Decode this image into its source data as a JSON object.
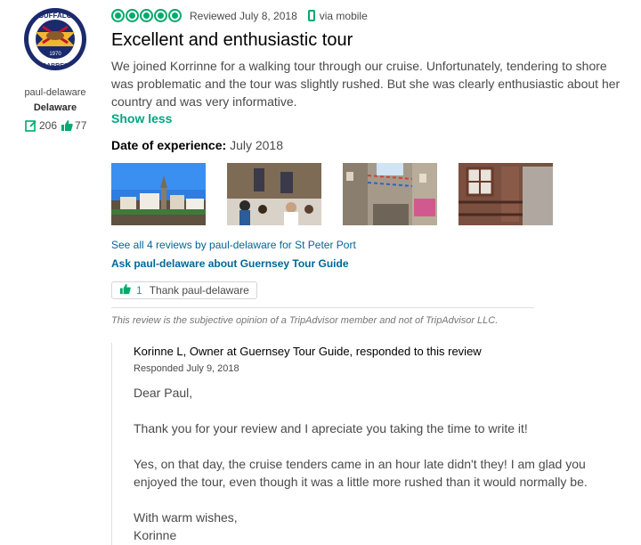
{
  "reviewer": {
    "avatar_text_top": "BUFFALO",
    "avatar_text_bottom": "SABRES",
    "avatar_text_year": "1970",
    "username": "paul-delaware",
    "location": "Delaware",
    "review_count": "206",
    "helpful_count": "77"
  },
  "review": {
    "rating_bubbles": 5,
    "reviewed_date": "Reviewed July 8, 2018",
    "via": "via mobile",
    "title": "Excellent and enthusiastic tour",
    "body": "We joined Korrinne for a walking tour through our cruise. Unfortunately, tendering to shore was problematic and the tour was slightly rushed. But she was clearly enthusiastic about her country and was very informative.",
    "show_less": "Show less",
    "date_of_experience_label": "Date of experience:",
    "date_of_experience_value": "July 2018",
    "see_all_link": "See all 4 reviews by paul-delaware for St Peter Port",
    "ask_link": "Ask paul-delaware about Guernsey Tour Guide",
    "thank_count": "1",
    "thank_label": "Thank paul-delaware",
    "disclaimer": "This review is the subjective opinion of a TripAdvisor member and not of TripAdvisor LLC."
  },
  "response": {
    "owner_line": "Korinne L, Owner at Guernsey Tour Guide, responded to this review",
    "date": "Responded July 9, 2018",
    "greeting": "Dear Paul,",
    "para1": "Thank you for your review and I apreciate you taking the time to write it!",
    "para2": "Yes, on that day, the cruise tenders came in an hour late didn't they! I am glad you enjoyed the tour, even though it was a little more rushed than it would normally be.",
    "closing": "With warm wishes,",
    "signature": "Korinne"
  },
  "colors": {
    "accent_green": "#00aa6c",
    "link_blue": "#006699"
  }
}
